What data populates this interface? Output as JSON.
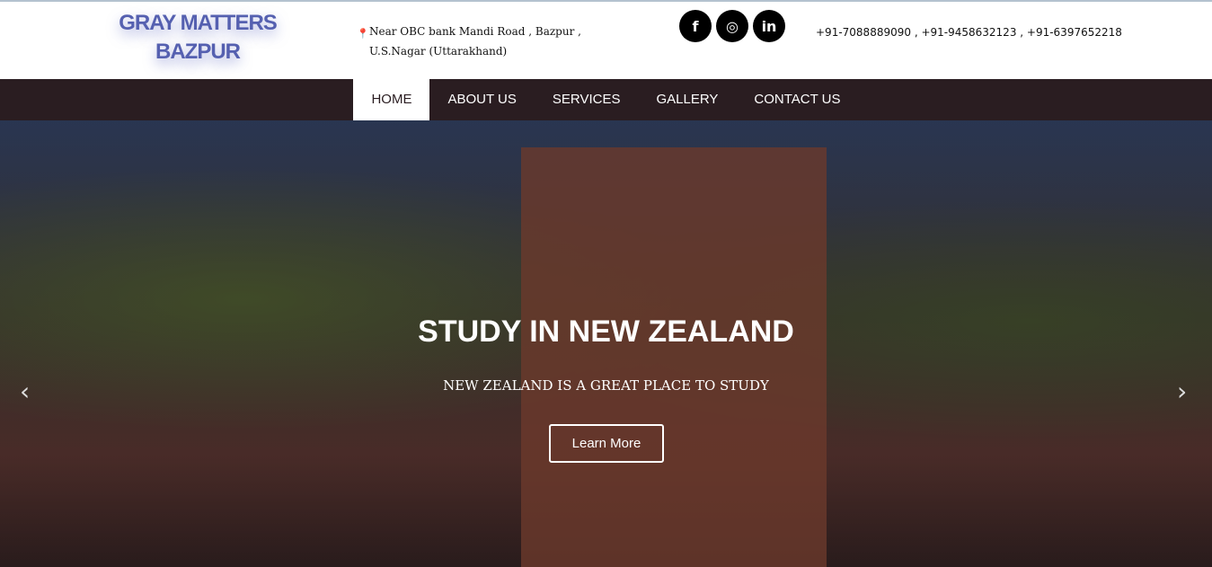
{
  "header": {
    "logo_line1": "GRAY MATTERS",
    "logo_line2": "BAZPUR",
    "address": "Near OBC bank Mandi Road , Bazpur , U.S.Nagar (Uttarakhand)",
    "phones": "+91-7088889090 ,  +91-9458632123 ,  +91-6397652218",
    "social": [
      {
        "icon": "facebook-icon",
        "glyph": "f"
      },
      {
        "icon": "instagram-icon",
        "glyph": "◎"
      },
      {
        "icon": "linkedin-icon",
        "glyph": "in"
      }
    ]
  },
  "nav": {
    "items": [
      "HOME",
      "ABOUT US",
      "SERVICES",
      "GALLERY",
      "CONTACT US"
    ],
    "active": "HOME"
  },
  "hero": {
    "title": "STUDY IN NEW ZEALAND",
    "subtitle": "NEW ZEALAND IS A GREAT PLACE TO STUDY",
    "button": "Learn More",
    "prev": "‹",
    "next": "›"
  }
}
